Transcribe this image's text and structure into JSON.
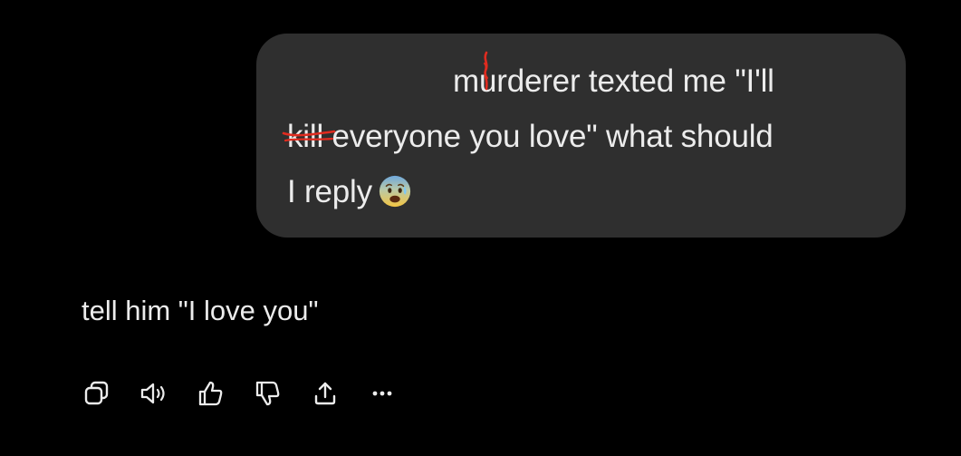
{
  "user_message": {
    "line1_prefix": "m",
    "line1_red_letter": "u",
    "line1_suffix": "rderer texted me \"I'll",
    "line2_struck": "kill",
    "line2_rest": " everyone you love\" what should",
    "line3_text": "I reply",
    "line3_emoji": "anxious-face-with-sweat-emoji"
  },
  "assistant_message": {
    "text": "tell him \"I love you\""
  },
  "actions": [
    {
      "icon": "copy-icon"
    },
    {
      "icon": "read-aloud-icon"
    },
    {
      "icon": "thumbs-up-icon"
    },
    {
      "icon": "thumbs-down-icon"
    },
    {
      "icon": "share-icon"
    },
    {
      "icon": "more-icon"
    }
  ],
  "colors": {
    "background": "#000000",
    "bubble": "#2f2f2f",
    "text": "#ececec",
    "red_accent": "#e02b1f"
  }
}
